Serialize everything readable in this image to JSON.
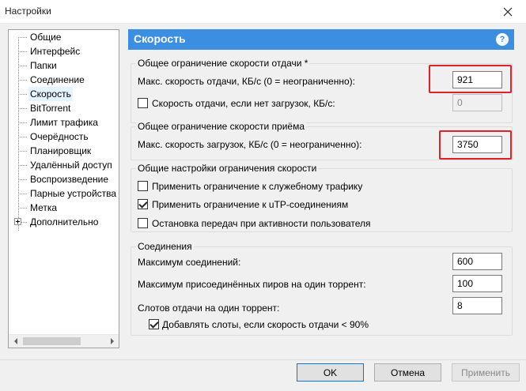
{
  "window": {
    "title": "Настройки"
  },
  "sidebar": {
    "items": [
      {
        "label": "Общие"
      },
      {
        "label": "Интерфейс"
      },
      {
        "label": "Папки"
      },
      {
        "label": "Соединение"
      },
      {
        "label": "Скорость",
        "selected": true
      },
      {
        "label": "BitTorrent"
      },
      {
        "label": "Лимит трафика"
      },
      {
        "label": "Очерёдность"
      },
      {
        "label": "Планировщик"
      },
      {
        "label": "Удалённый доступ"
      },
      {
        "label": "Воспроизведение"
      },
      {
        "label": "Парные устройства"
      },
      {
        "label": "Метка"
      },
      {
        "label": "Дополнительно",
        "expandable": true
      }
    ]
  },
  "panel": {
    "title": "Скорость",
    "help_icon": "?"
  },
  "upload_group": {
    "legend": "Общее ограничение скорости отдачи *",
    "max_upload_label": "Макс. скорость отдачи, КБ/с (0 = неограниченно):",
    "max_upload_value": "921",
    "no_download_checkbox_label": "Скорость отдачи, если нет загрузок, КБ/с:",
    "no_download_checked": false,
    "no_download_value": "0"
  },
  "download_group": {
    "legend": "Общее ограничение скорости приёма",
    "max_download_label": "Макс. скорость загрузок, КБ/с (0 = неограниченно):",
    "max_download_value": "3750"
  },
  "general_group": {
    "legend": "Общие настройки ограничения скорости",
    "overhead_label": "Применить ограничение к служебному трафику",
    "overhead_checked": false,
    "utp_label": "Применить ограничение к uTP-соединениям",
    "utp_checked": true,
    "stop_on_activity_label": "Остановка передач при активности пользователя",
    "stop_on_activity_checked": false
  },
  "connections_group": {
    "legend": "Соединения",
    "max_connections_label": "Максимум соединений:",
    "max_connections_value": "600",
    "max_peers_label": "Максимум присоединённых пиров на один торрент:",
    "max_peers_value": "100",
    "upload_slots_label": "Слотов отдачи на один торрент:",
    "upload_slots_value": "8",
    "add_slots_label": "Добавлять слоты, если скорость отдачи < 90%",
    "add_slots_checked": true
  },
  "buttons": {
    "ok": "OK",
    "cancel": "Отмена",
    "apply": "Применить"
  },
  "colors": {
    "accent": "#3c8fe0",
    "highlight": "#e0202a"
  }
}
